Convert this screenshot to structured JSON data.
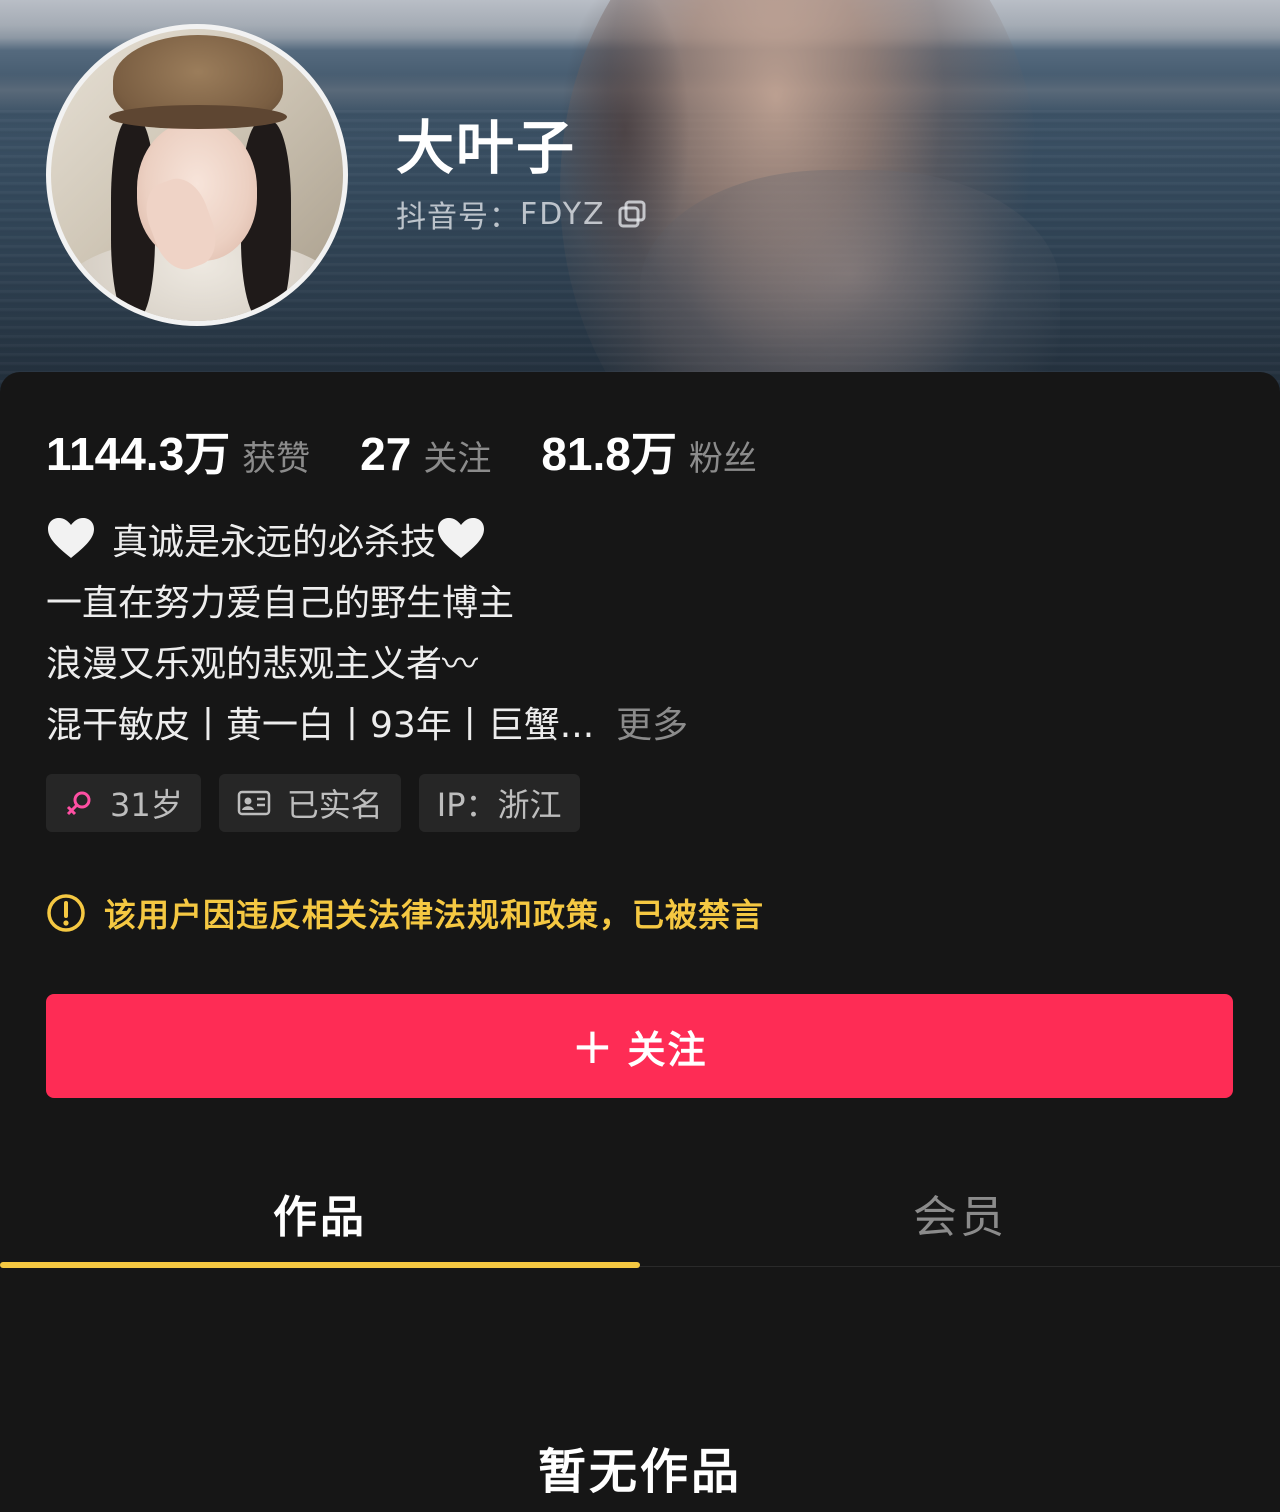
{
  "profile": {
    "username": "大叶子",
    "douyin_id_label": "抖音号：",
    "douyin_id": "FDYZ"
  },
  "stats": [
    {
      "value": "1144.3万",
      "label": "获赞"
    },
    {
      "value": "27",
      "label": "关注"
    },
    {
      "value": "81.8万",
      "label": "粉丝"
    }
  ],
  "bio": {
    "line1": "真诚是永远的必杀技",
    "line2": "一直在努力爱自己的野生博主",
    "line3": "浪漫又乐观的悲观主义者〰",
    "line4": "混干敏皮丨黄一白丨93年丨巨蟹...",
    "more": "更多"
  },
  "tags": {
    "age": "31岁",
    "verified": "已实名",
    "ip": "IP：浙江"
  },
  "notice": {
    "text": "该用户因违反相关法律法规和政策，已被禁言",
    "color": "#f5c842"
  },
  "follow_button": {
    "plus": "+",
    "label": "关注",
    "color": "#fe2c55"
  },
  "tabs": [
    {
      "label": "作品",
      "active": true
    },
    {
      "label": "会员",
      "active": false
    }
  ],
  "empty_state": "暂无作品",
  "icons": {
    "heart": "white-heart-emoji",
    "gender": "female-icon",
    "verified": "id-card-icon",
    "warning": "exclamation-circle-icon",
    "copy": "copy-icon"
  }
}
